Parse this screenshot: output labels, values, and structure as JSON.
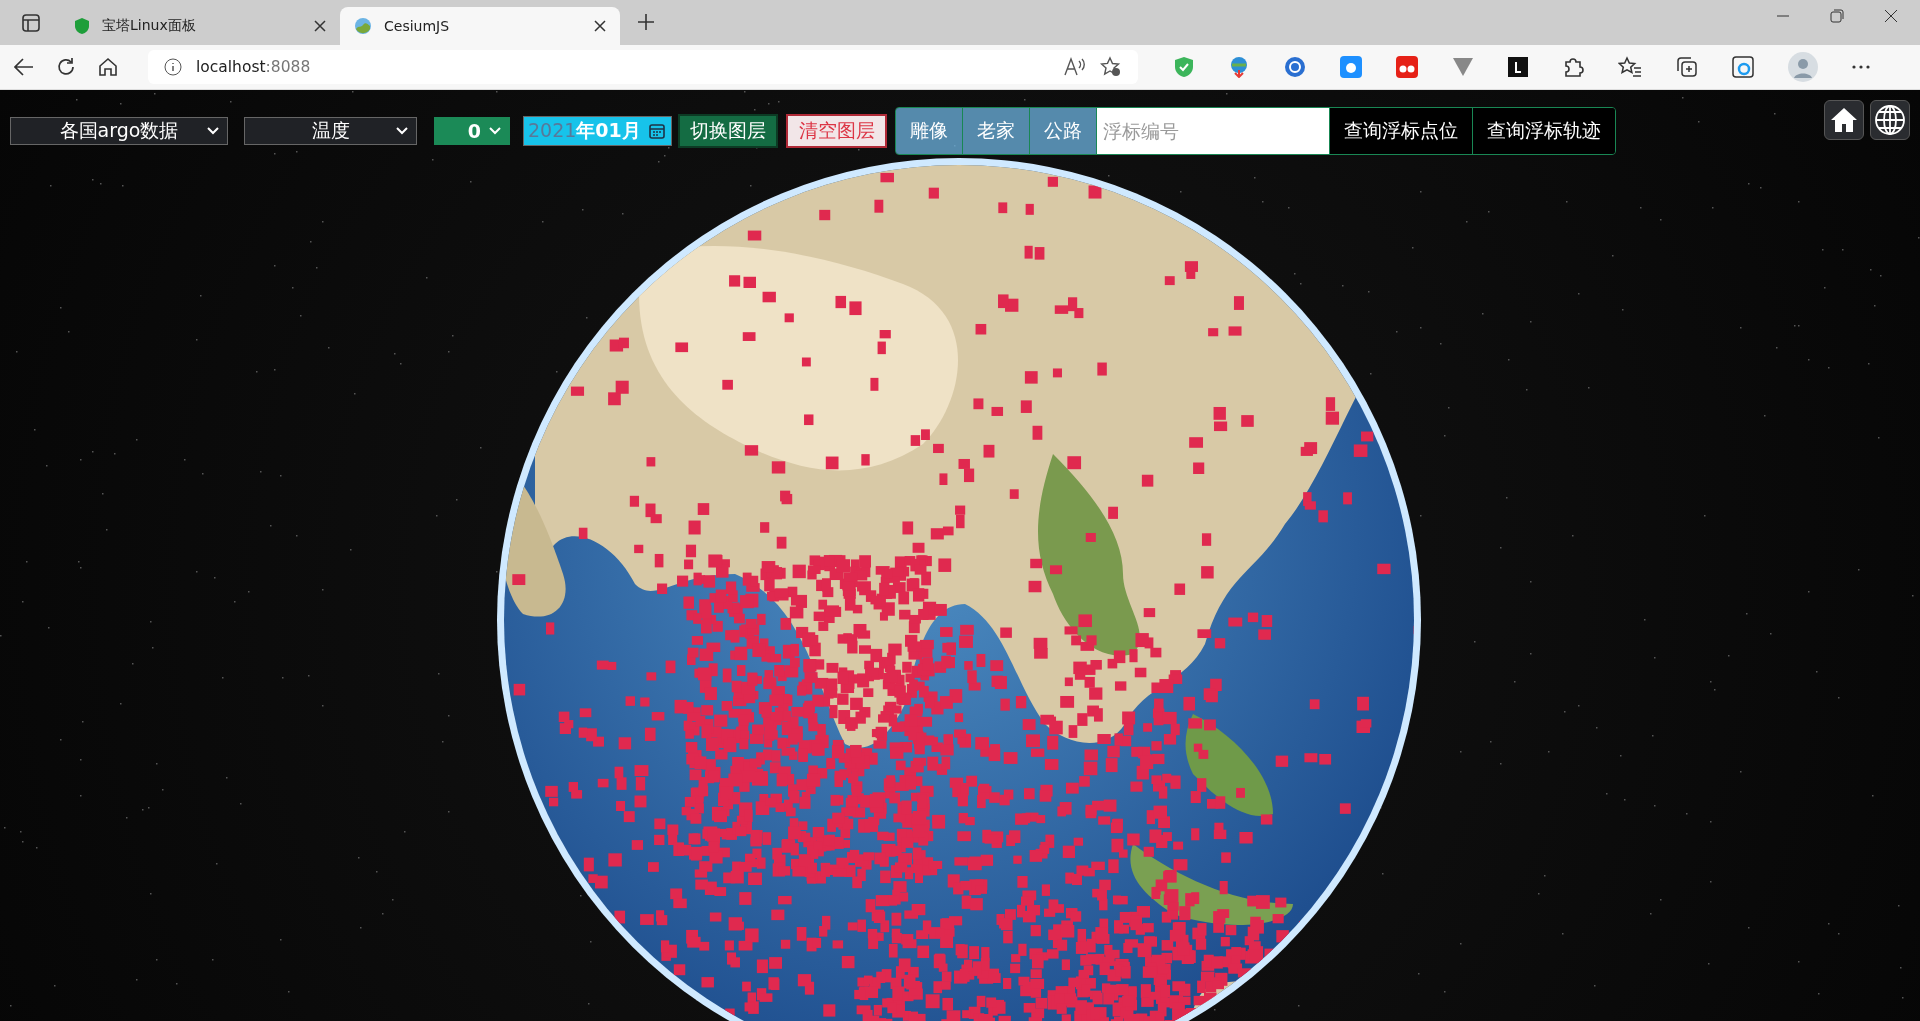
{
  "browser": {
    "tabs": [
      {
        "title": "宝塔Linux面板",
        "selected": false
      },
      {
        "title": "CesiumJS",
        "selected": true
      }
    ],
    "address": {
      "host": "localhost",
      "port": ":8088"
    }
  },
  "toolbar": {
    "dataset_select": "各国argo数据",
    "variable_select": "温度",
    "depth_select": "0",
    "date_field": {
      "year": "2021",
      "rest": "年01月"
    },
    "switch_layer_button": "切换图层",
    "clear_layer_button": "清空图层",
    "basemaps": [
      {
        "label": "雕像"
      },
      {
        "label": "老家"
      },
      {
        "label": "公路"
      }
    ],
    "float_id_field": {
      "placeholder": "浮标编号"
    },
    "query_buttons": [
      "查询浮标点位",
      "查询浮标轨迹"
    ]
  }
}
